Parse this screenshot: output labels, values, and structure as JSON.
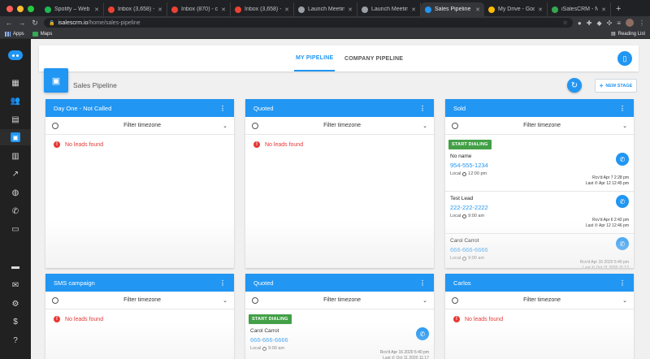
{
  "browser": {
    "colors": {
      "close": "#ff5f57",
      "minimize": "#febc2e",
      "maximize": "#28c840"
    },
    "tabs": [
      {
        "title": "Spotify – Web Player",
        "favicon_color": "#1db954"
      },
      {
        "title": "Inbox (3,658) - connor",
        "favicon_color": "#ea4335"
      },
      {
        "title": "Inbox (870) - carlos",
        "favicon_color": "#ea4335"
      },
      {
        "title": "Inbox (3,658) - connor",
        "favicon_color": "#ea4335"
      },
      {
        "title": "Launch Meeting - Zoom",
        "favicon_color": "#9aa0a6"
      },
      {
        "title": "Launch Meeting - Zoom",
        "favicon_color": "#9aa0a6"
      },
      {
        "title": "Sales Pipeline - iSalesCRM",
        "favicon_color": "#2196f3",
        "active": true
      },
      {
        "title": "My Drive - Google Drive",
        "favicon_color": "#fbbc04"
      },
      {
        "title": "iSalesCRM - New Lead",
        "favicon_color": "#34a853"
      }
    ],
    "new_tab": "+",
    "url": {
      "domain": "isalescrm.io",
      "path": "/home/sales-pipeline"
    },
    "bookmarks": [
      {
        "label": "Apps"
      },
      {
        "label": "Maps"
      }
    ],
    "reading_list": "Reading List"
  },
  "sidebar": {
    "items": [
      {
        "icon": "dashboard-icon",
        "glyph": "▦"
      },
      {
        "icon": "people-icon",
        "glyph": "👥"
      },
      {
        "icon": "chat-icon",
        "glyph": "▤"
      },
      {
        "icon": "contacts-icon",
        "glyph": "▣",
        "active": true
      },
      {
        "icon": "calendar-icon",
        "glyph": "▥"
      },
      {
        "icon": "trending-icon",
        "glyph": "↗"
      },
      {
        "icon": "globe-icon",
        "glyph": "◍"
      },
      {
        "icon": "phone-icon",
        "glyph": "✆"
      },
      {
        "icon": "devices-icon",
        "glyph": "▭"
      },
      {
        "icon": "message-icon",
        "glyph": "▬"
      },
      {
        "icon": "mail-icon",
        "glyph": "✉"
      },
      {
        "icon": "settings-icon",
        "glyph": "⚙"
      },
      {
        "icon": "dollar-icon",
        "glyph": "$"
      },
      {
        "icon": "help-icon",
        "glyph": "?"
      }
    ]
  },
  "subnav": {
    "tabs": [
      "MY PIPELINE",
      "COMPANY PIPELINE"
    ]
  },
  "page": {
    "title": "Sales Pipeline",
    "new_stage": "NEW STAGE",
    "accent": "#2196f3"
  },
  "stages": [
    {
      "title": "Day One - Not Called",
      "filter": "Filter timezone",
      "no_leads": "No leads found"
    },
    {
      "title": "Quoted",
      "filter": "Filter timezone",
      "no_leads": "No leads found"
    },
    {
      "title": "Sold",
      "filter": "Filter timezone",
      "start_dialing": "START DIALING",
      "leads": [
        {
          "name": "No name",
          "phone": "954-555-1234",
          "local": "Local",
          "time": "12:00 pm",
          "rcvd": "Rcv'd Apr 7 2:28 pm",
          "last": "Last",
          "last_time": "Apr 12 12:45 pm"
        },
        {
          "name": "Test Lead",
          "phone": "222-222-2222",
          "local": "Local",
          "time": "9:00 am",
          "rcvd": "Rcv'd Apr 6 2:42 pm",
          "last": "Last",
          "last_time": "Apr 12 12:46 pm"
        },
        {
          "name": "Carol Carrot",
          "phone": "666-666-6666",
          "local": "Local",
          "time": "9:00 am",
          "rcvd": "Rcv'd Apr 16 2020 5:40 pm",
          "last": "Last",
          "last_time": "Oct 11 2020 11:17"
        }
      ]
    },
    {
      "title": "SMS campaign",
      "filter": "Filter timezone",
      "no_leads": "No leads found"
    },
    {
      "title": "Quoted",
      "filter": "Filter timezone",
      "start_dialing": "START DIALING",
      "leads": [
        {
          "name": "Carol Carrot",
          "phone": "666-666-6666",
          "local": "Local",
          "time": "9:00 am",
          "rcvd": "Rcv'd Apr 16 2020 5:40 pm",
          "last": "Last",
          "last_time": "Oct 11 2020 11:17"
        }
      ]
    },
    {
      "title": "Carlos",
      "filter": "Filter timezone",
      "no_leads": "No leads found"
    }
  ]
}
